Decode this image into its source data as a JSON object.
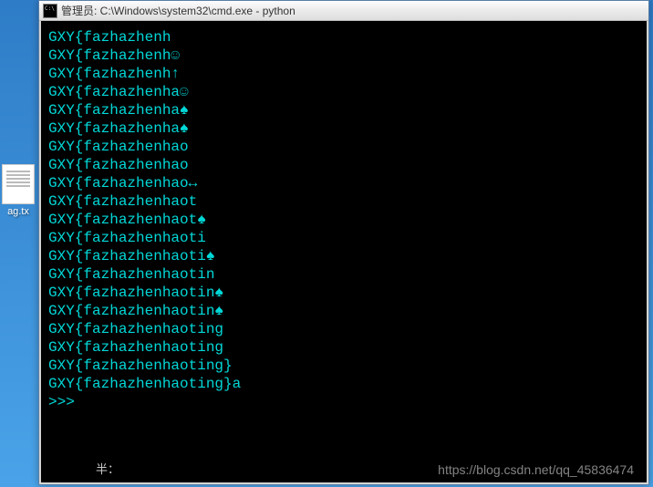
{
  "desktop": {
    "icon_label": "ag.tx"
  },
  "window": {
    "title": "管理员: C:\\Windows\\system32\\cmd.exe - python"
  },
  "terminal": {
    "lines": [
      "GXY{fazhazhenh",
      "GXY{fazhazhenh☺",
      "GXY{fazhazhenh↑",
      "GXY{fazhazhenha☺",
      "GXY{fazhazhenha♠",
      "GXY{fazhazhenha♠",
      "GXY{fazhazhenhao",
      "GXY{fazhazhenhao",
      "GXY{fazhazhenhao↔",
      "GXY{fazhazhenhaot",
      "GXY{fazhazhenhaot♠",
      "GXY{fazhazhenhaoti",
      "GXY{fazhazhenhaoti♠",
      "GXY{fazhazhenhaotin",
      "GXY{fazhazhenhaotin♠",
      "GXY{fazhazhenhaotin♠",
      "GXY{fazhazhenhaoting",
      "GXY{fazhazhenhaoting",
      "GXY{fazhazhenhaoting}",
      "GXY{fazhazhenhaoting}a"
    ],
    "prompt": ">>>"
  },
  "status": {
    "ime": "半："
  },
  "watermark": {
    "text": "https://blog.csdn.net/qq_45836474"
  }
}
